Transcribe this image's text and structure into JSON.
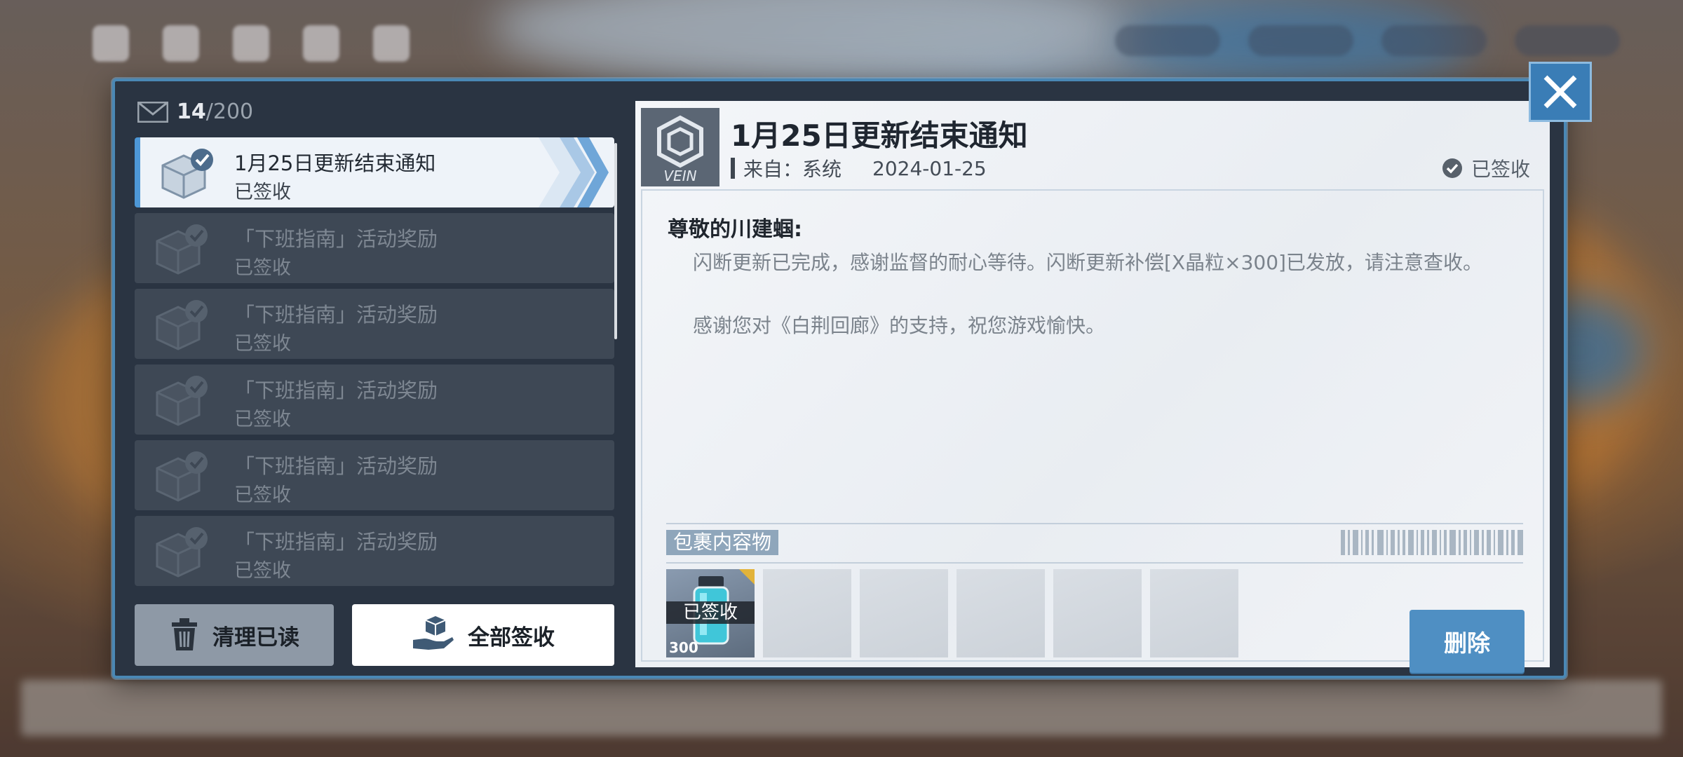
{
  "mail_counter": {
    "current": "14",
    "separator": "/",
    "max": "200"
  },
  "mail_list": [
    {
      "title": "1月25日更新结束通知",
      "status": "已签收",
      "selected": true
    },
    {
      "title": "「下班指南」活动奖励",
      "status": "已签收",
      "selected": false
    },
    {
      "title": "「下班指南」活动奖励",
      "status": "已签收",
      "selected": false
    },
    {
      "title": "「下班指南」活动奖励",
      "status": "已签收",
      "selected": false
    },
    {
      "title": "「下班指南」活动奖励",
      "status": "已签收",
      "selected": false
    },
    {
      "title": "「下班指南」活动奖励",
      "status": "已签收",
      "selected": false
    }
  ],
  "buttons": {
    "clear_read": "清理已读",
    "claim_all": "全部签收",
    "delete": "删除"
  },
  "mail_detail": {
    "title": "1月25日更新结束通知",
    "from_label": "来自：系统",
    "date": "2024-01-25",
    "received_status": "已签收",
    "greeting": "尊敬的川建蝈:",
    "paragraph1": "闪断更新已完成，感谢监督的耐心等待。闪断更新补偿[Ⅹ晶粒×300]已发放，请注意查收。",
    "paragraph2": "感谢您对《白荆回廊》的支持，祝您游戏愉快。"
  },
  "attachments": {
    "label": "包裹内容物",
    "items": [
      {
        "status": "已签收",
        "quantity": "300"
      }
    ],
    "empty_slots": 5
  },
  "colors": {
    "accent": "#4d97d6",
    "delete_button": "#4f8fc3",
    "frame": "#2a3442"
  }
}
